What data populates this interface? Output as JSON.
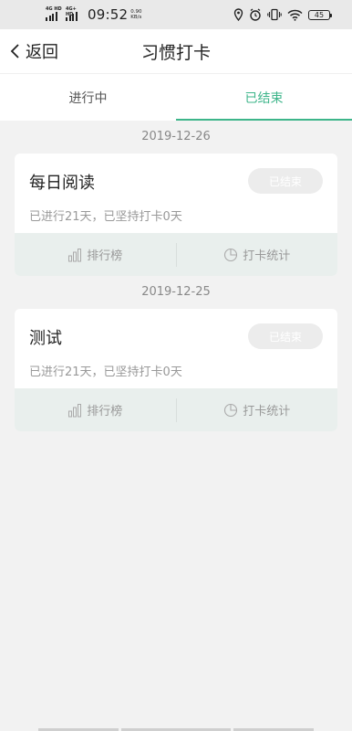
{
  "status_bar": {
    "signal1_label": "4G HD",
    "signal2_label": "4G+ HD",
    "time": "09:52",
    "speed_value": "0.90",
    "speed_unit": "KB/s",
    "battery": "45"
  },
  "nav": {
    "back_label": "返回",
    "title": "习惯打卡"
  },
  "tabs": [
    {
      "label": "进行中",
      "active": false
    },
    {
      "label": "已结束",
      "active": true
    }
  ],
  "colors": {
    "accent": "#3db58a",
    "background": "#f2f2f2",
    "actions_bg": "#e9efed"
  },
  "habits": [
    {
      "date": "2019-12-26",
      "title": "每日阅读",
      "summary": "已进行21天，已坚持打卡0天",
      "status": "已结束",
      "ranking_label": "排行榜",
      "stats_label": "打卡统计"
    },
    {
      "date": "2019-12-25",
      "title": "测试",
      "summary": "已进行21天，已坚持打卡0天",
      "status": "已结束",
      "ranking_label": "排行榜",
      "stats_label": "打卡统计"
    }
  ]
}
